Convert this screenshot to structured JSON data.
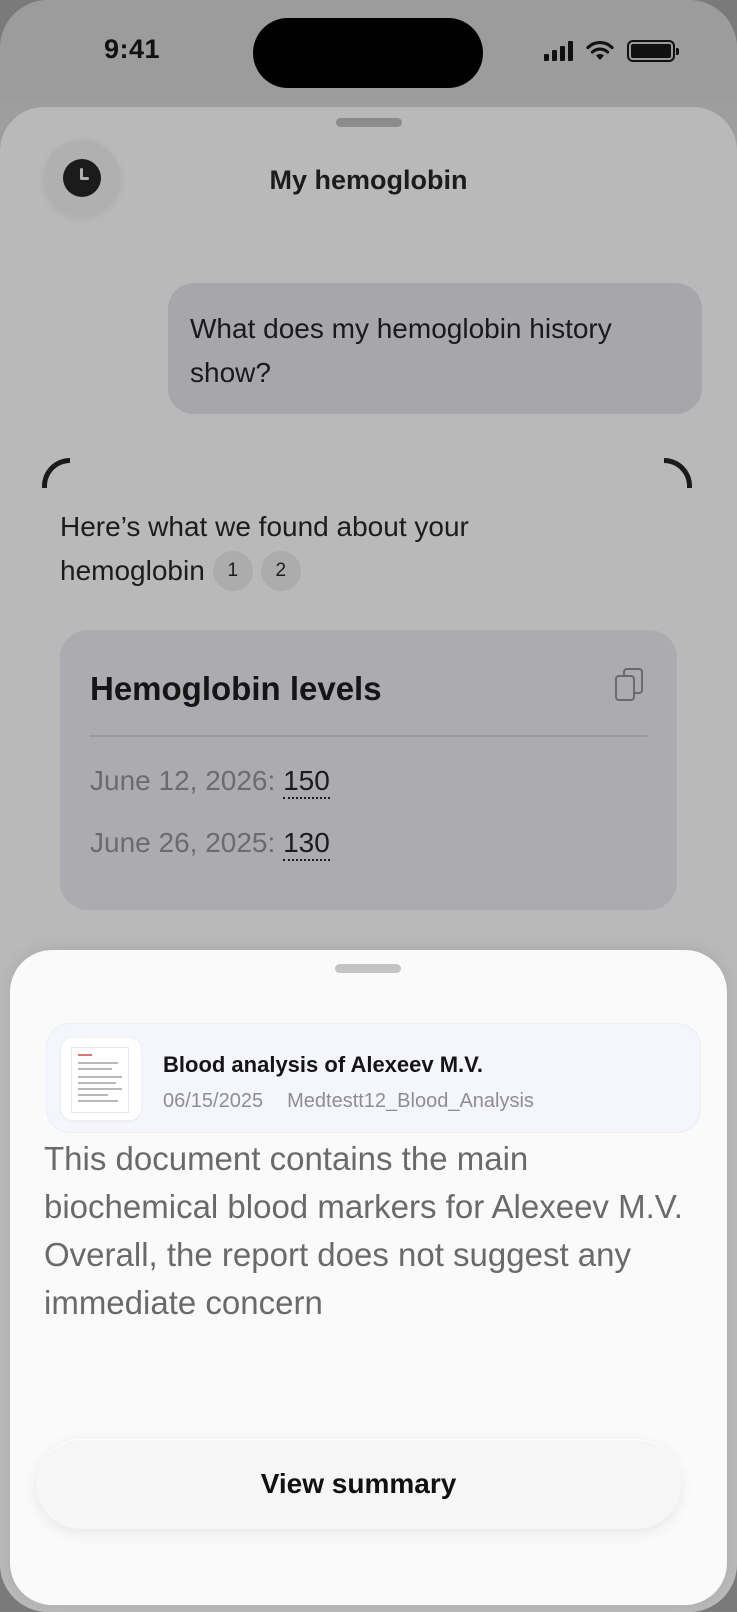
{
  "status_bar": {
    "time": "9:41",
    "battery_level": 1.0
  },
  "header": {
    "title": "My hemoglobin",
    "history_icon": "clock-icon"
  },
  "chat": {
    "user_message": "What does my hemoglobin history show?",
    "assistant_intro": "Here’s what we found about your hemoglobin",
    "references": [
      "1",
      "2"
    ]
  },
  "card": {
    "title": "Hemoglobin levels",
    "copy_icon": "copy-icon",
    "levels": [
      {
        "date": "June 12, 2026:",
        "value": "150"
      },
      {
        "date": "June 26, 2025:",
        "value": "130"
      }
    ]
  },
  "document": {
    "title": "Blood analysis of Alexeev M.V.",
    "date": "06/15/2025",
    "filename": "Medtestt12_Blood_Analysis",
    "summary": "This document contains the main biochemical blood markers for Alexeev M.V. Overall, the report does not suggest any immediate concern"
  },
  "actions": {
    "view_summary_label": "View summary"
  }
}
